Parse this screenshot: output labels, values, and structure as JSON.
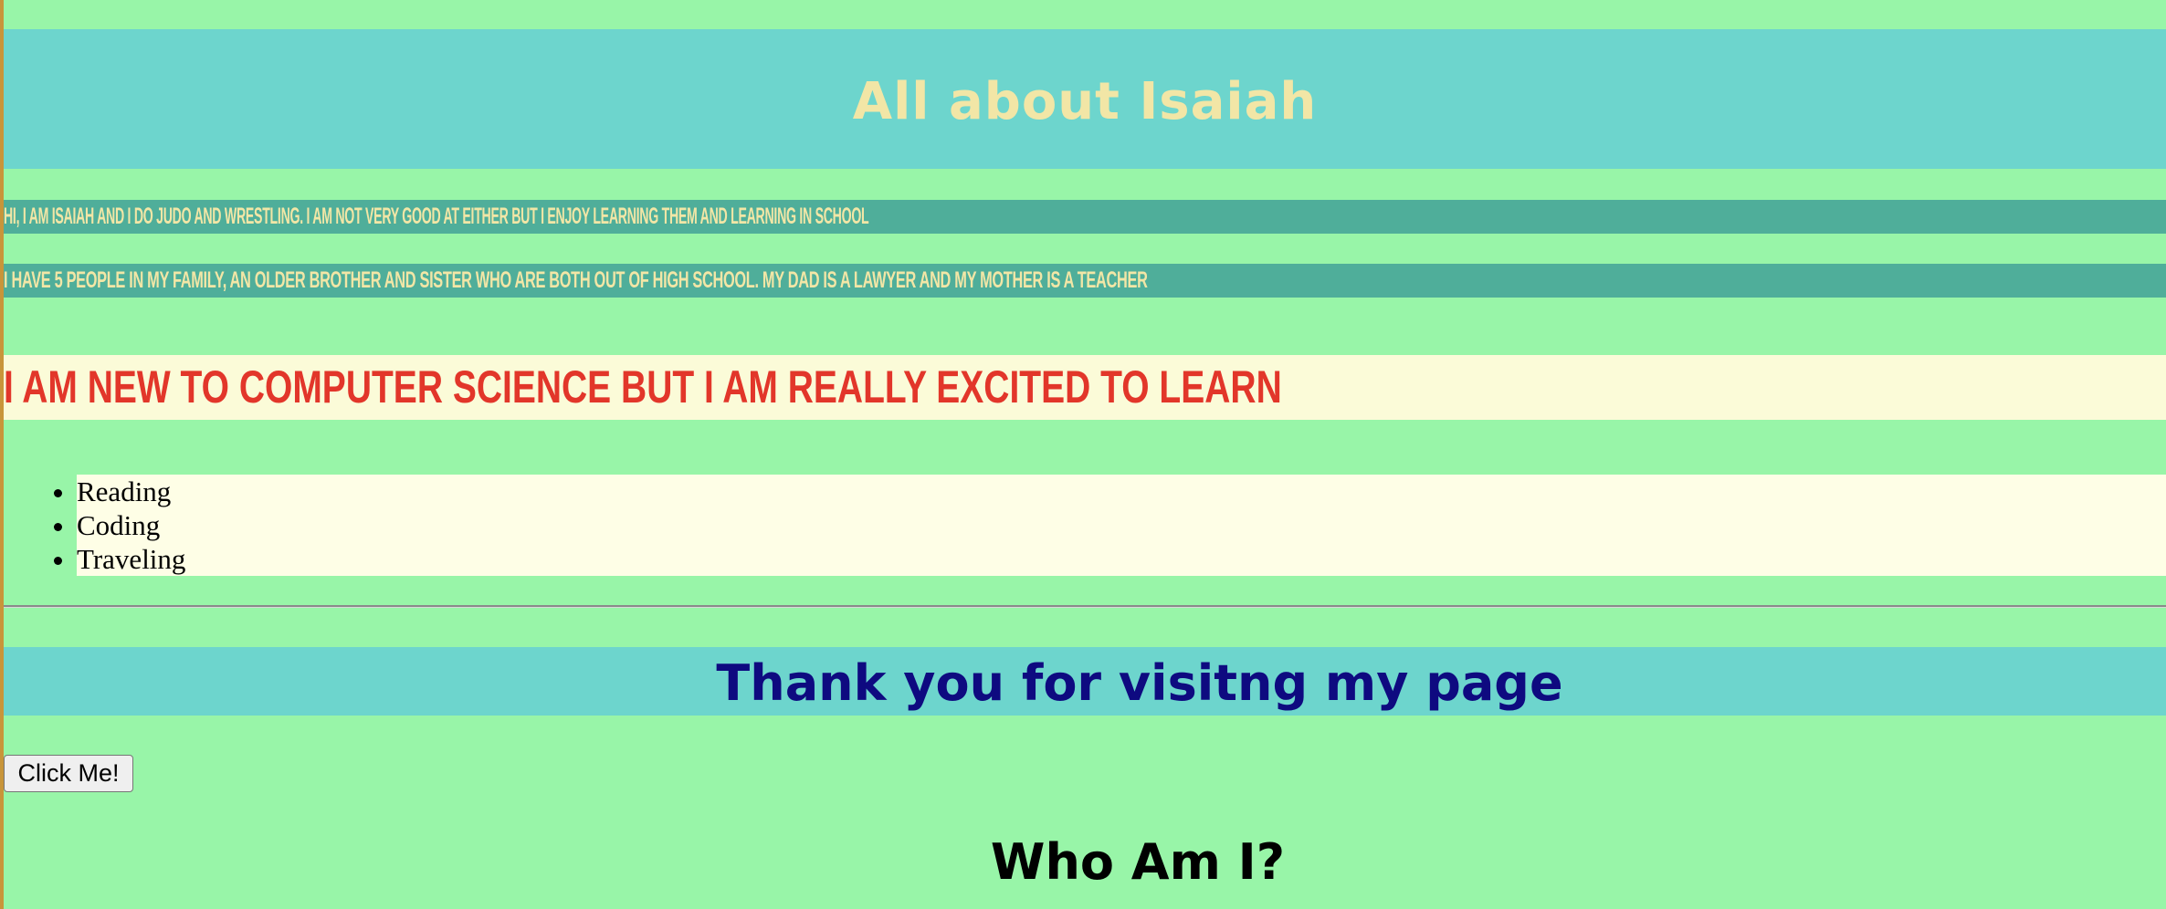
{
  "header": {
    "title": "All about Isaiah"
  },
  "about": {
    "intro": "Hi, I am Isaiah and I do Judo and wrestling. I am not very good at either but I enjoy learning them and learning in school",
    "family": "I have 5 people in my family, an older brother and sister who are both out of high school. My dad is a lawyer and my mother is a teacher"
  },
  "computer_science": {
    "heading": "I am new to Computer Science but I am really excited to learn"
  },
  "hobbies": {
    "items": [
      "Reading",
      "Coding",
      "Traveling"
    ]
  },
  "footer": {
    "thanks": "Thank you for visitng my page",
    "button_label": "Click Me!",
    "who_heading": "Who Am I?"
  },
  "colors": {
    "page_background": "#98f5a8",
    "banner": "#6dd5cd",
    "strip": "#4fae9a",
    "title_text": "#f2e6a6",
    "cs_heading_text": "#e2362a",
    "thanks_text": "#0e0a80"
  }
}
